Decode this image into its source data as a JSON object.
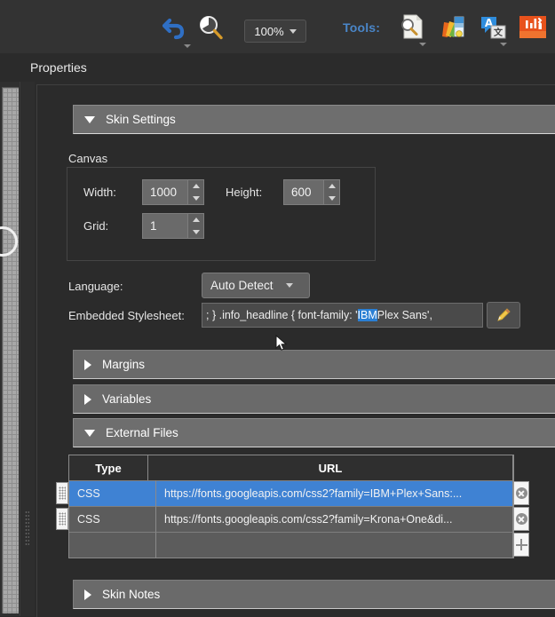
{
  "toolbar": {
    "undo_icon": "undo-arrow-icon",
    "zoom_icon": "magnifier-icon",
    "zoom_level": "100%",
    "tools_label": "Tools:",
    "tools": [
      {
        "name": "document-inspector-icon",
        "title": "Inspect"
      },
      {
        "name": "color-palette-icon",
        "title": "Colors"
      },
      {
        "name": "translate-icon",
        "title": "Translate"
      },
      {
        "name": "toolbox-icon",
        "title": "Toolbox"
      }
    ],
    "accent_blue": "#4a86c8"
  },
  "page_title": "Properties",
  "sections": {
    "skin_settings": {
      "label": "Skin Settings",
      "expanded": true,
      "canvas": {
        "group_label": "Canvas",
        "width_label": "Width:",
        "width_value": "1000",
        "height_label": "Height:",
        "height_value": "600",
        "grid_label": "Grid:",
        "grid_value": "1"
      },
      "language_label": "Language:",
      "language_value": "Auto Detect",
      "stylesheet_label": "Embedded Stylesheet:",
      "stylesheet_before": "; }  .info_headline { font-family: '",
      "stylesheet_selected": "IBM",
      "stylesheet_after": " Plex Sans',",
      "edit_button_icon": "pencil-icon"
    },
    "margins": {
      "label": "Margins",
      "expanded": false
    },
    "variables": {
      "label": "Variables",
      "expanded": false
    },
    "external_files": {
      "label": "External Files",
      "expanded": true,
      "columns": [
        "Type",
        "URL"
      ],
      "rows": [
        {
          "type": "CSS",
          "url": "https://fonts.googleapis.com/css2?family=IBM+Plex+Sans:...",
          "selected": true
        },
        {
          "type": "CSS",
          "url": "https://fonts.googleapis.com/css2?family=Krona+One&di...",
          "selected": false
        }
      ],
      "add_row_icon": "plus-icon",
      "delete_row_icon": "delete-circle-icon",
      "drag_handle_icon": "drag-grip-icon"
    },
    "skin_notes": {
      "label": "Skin Notes",
      "expanded": false
    }
  },
  "colors": {
    "app_background": "#2b2b2b",
    "toolbar_background": "#333333",
    "section_header": "#6e6e6e",
    "selection_blue": "#3f82d3",
    "text_highlight": "#2a7fd4"
  }
}
